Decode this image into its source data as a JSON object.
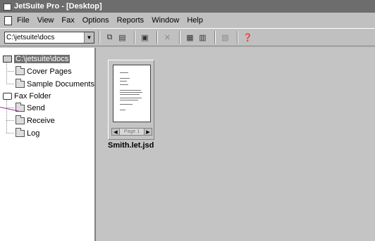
{
  "window": {
    "title": "JetSuite Pro - [Desktop]"
  },
  "menu": [
    "File",
    "View",
    "Fax",
    "Options",
    "Reports",
    "Window",
    "Help"
  ],
  "toolbar": {
    "path_value": "C:\\jetsuite\\docs",
    "buttons": [
      {
        "icon": "copy-icon",
        "glyph": "⧉",
        "enabled": true
      },
      {
        "icon": "paste-icon",
        "glyph": "▤",
        "enabled": true
      },
      {
        "icon": "print-icon",
        "glyph": "▣",
        "enabled": true
      },
      {
        "icon": "delete-icon",
        "glyph": "✕",
        "enabled": false
      },
      {
        "icon": "large-icons-view-icon",
        "glyph": "▦",
        "enabled": true
      },
      {
        "icon": "details-view-icon",
        "glyph": "▥",
        "enabled": true
      },
      {
        "icon": "list-view-icon",
        "glyph": "▧",
        "enabled": false
      },
      {
        "icon": "help-pointer-icon",
        "glyph": "❓",
        "enabled": true
      }
    ]
  },
  "tree": {
    "root": "C:\\jetsuite\\docs",
    "root_children": [
      "Cover Pages",
      "Sample Documents"
    ],
    "fax_folder": "Fax Folder",
    "fax_children": [
      "Send",
      "Receive",
      "Log"
    ]
  },
  "thumbnail": {
    "filename": "Smith.let.jsd",
    "page_label": "Page 1"
  },
  "colors": {
    "titlebar": "#6d6d6d",
    "callout": "#9c2a8e",
    "workspace": "#c4c4c4"
  }
}
